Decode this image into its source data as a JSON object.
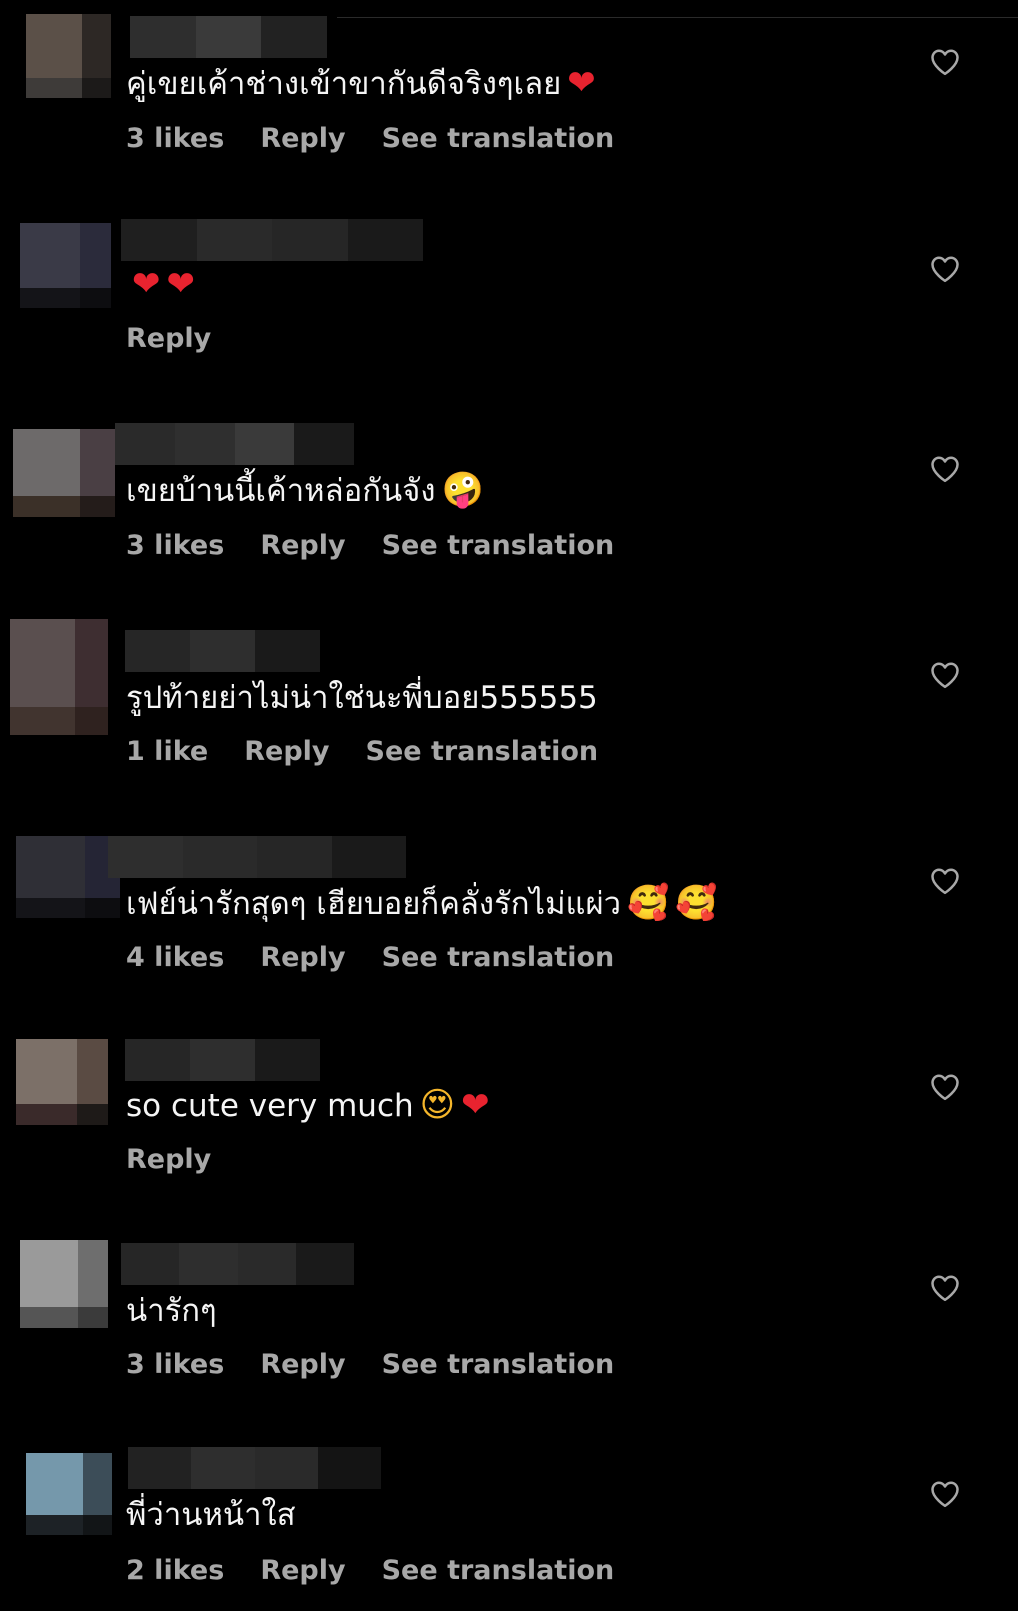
{
  "comments": [
    {
      "username": "",
      "text": "คู่เขยเค้าช่างเข้าขากันดีจริงๆเลย",
      "emoji": [
        {
          "glyph": "❤",
          "kind": "heart"
        }
      ],
      "likes": "3 likes",
      "reply": "Reply",
      "translation": "See translation"
    },
    {
      "username": "",
      "text": "",
      "emoji": [
        {
          "glyph": "❤",
          "kind": "heart"
        },
        {
          "glyph": "❤",
          "kind": "heart"
        }
      ],
      "likes": "",
      "reply": "Reply",
      "translation": ""
    },
    {
      "username": "",
      "text": "เขยบ้านนี้เค้าหล่อกันจัง",
      "emoji": [
        {
          "glyph": "🤪",
          "kind": "face"
        }
      ],
      "likes": "3 likes",
      "reply": "Reply",
      "translation": "See translation"
    },
    {
      "username": "",
      "text": "รูปท้ายย่าไม่น่าใช่นะพี่บอย555555",
      "emoji": [],
      "likes": "1 like",
      "reply": "Reply",
      "translation": "See translation"
    },
    {
      "username": "",
      "text": "เฟย์น่ารักสุดๆ เฮียบอยก็คลั่งรักไม่แผ่ว",
      "emoji": [
        {
          "glyph": "🥰",
          "kind": "face"
        },
        {
          "glyph": "🥰",
          "kind": "face"
        }
      ],
      "likes": "4 likes",
      "reply": "Reply",
      "translation": "See translation"
    },
    {
      "username": "",
      "text": "so cute very much",
      "emoji": [
        {
          "glyph": "😍",
          "kind": "face"
        },
        {
          "glyph": "❤",
          "kind": "heart"
        }
      ],
      "likes": "",
      "reply": "Reply",
      "translation": ""
    },
    {
      "username": "",
      "text": "น่ารักๆ",
      "emoji": [],
      "likes": "3 likes",
      "reply": "Reply",
      "translation": "See translation"
    },
    {
      "username": "",
      "text": "พี่ว่านหน้าใส",
      "emoji": [],
      "likes": "2 likes",
      "reply": "Reply",
      "translation": "See translation"
    }
  ],
  "icons": {
    "like": "heart-outline-icon"
  },
  "colors": {
    "background": "#000000",
    "primary_text": "#f5f5f5",
    "secondary_text": "#a8a8a8",
    "heart_emoji": "#e8232f"
  }
}
